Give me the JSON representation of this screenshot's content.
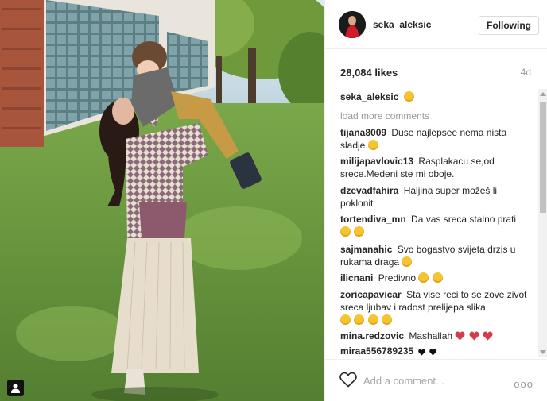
{
  "post": {
    "username": "seka_aleksic",
    "follow_label": "Following",
    "likes": "28,084 likes",
    "age": "4d",
    "caption_username": "seka_aleksic",
    "load_more": "load more comments",
    "add_comment_placeholder": "Add a comment...",
    "more_label": "ooo"
  },
  "comments": [
    {
      "user": "tijana8009",
      "text": "Duse najlepsee nema nista sladje"
    },
    {
      "user": "milijapavlovic13",
      "text": "Rasplakacu se,od srece.Medeni ste mi oboje."
    },
    {
      "user": "dzevadfahira",
      "text": "Haljina super možeš li poklonit"
    },
    {
      "user": "tortendiva_mn",
      "text": "Da vas sreca stalno prati"
    },
    {
      "user": "sajmanahic",
      "text": "Svo bogastvo svijeta drzis u rukama draga"
    },
    {
      "user": "ilicnani",
      "text": "Predivno"
    },
    {
      "user": "zoricapavicar",
      "text": "Sta vise reci to se zove zivot sreca ljubav i radost prelijepa slika"
    },
    {
      "user": "mina.redzovic",
      "text": "Mashallah"
    },
    {
      "user": "miraa556789235",
      "text": ""
    }
  ],
  "colors": {
    "accent_text": "#262626",
    "muted_text": "#999999",
    "heart_red": "#e0245e",
    "emoji_yellow": "#f5c430"
  },
  "icons": [
    "user-tag-icon",
    "heart-icon",
    "more-options-icon",
    "emoji-icon"
  ]
}
